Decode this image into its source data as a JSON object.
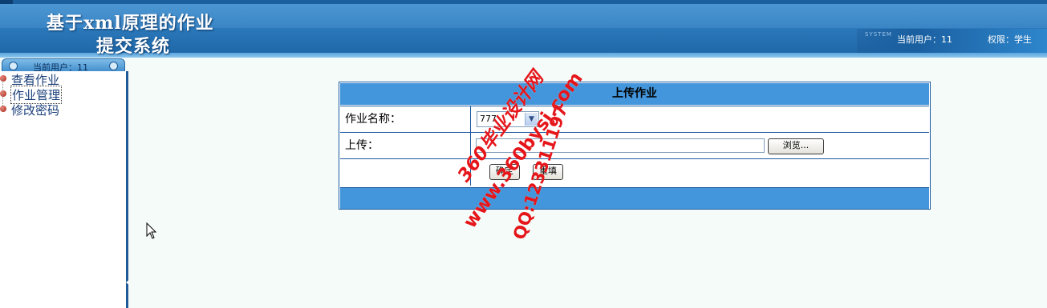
{
  "header": {
    "title_line1": "基于xml原理的作业",
    "title_line2": "提交系统",
    "system_tag": "SYSTEM",
    "current_user": "当前用户：11",
    "role": "权限：学生"
  },
  "sidebar": {
    "tab_label": "当前用户：11",
    "items": [
      {
        "label": "查看作业"
      },
      {
        "label": "作业管理"
      },
      {
        "label": "修改密码"
      }
    ]
  },
  "form": {
    "title": "上传作业",
    "homework_name_label": "作业名称：",
    "homework_selected": "777",
    "upload_label": "上传：",
    "browse_label": "浏览...",
    "confirm_label": "确定",
    "reset_label": "重填"
  },
  "watermark": {
    "line1": "360毕业设计网",
    "line2": "www.360bysj.com",
    "line3": "QQ:123311197"
  },
  "colors": {
    "header_blue": "#2a72b6",
    "form_header": "#4396db",
    "form_border": "#1d5aa0",
    "nav_bullet": "#a51d12",
    "watermark_red": "#e5151a"
  }
}
